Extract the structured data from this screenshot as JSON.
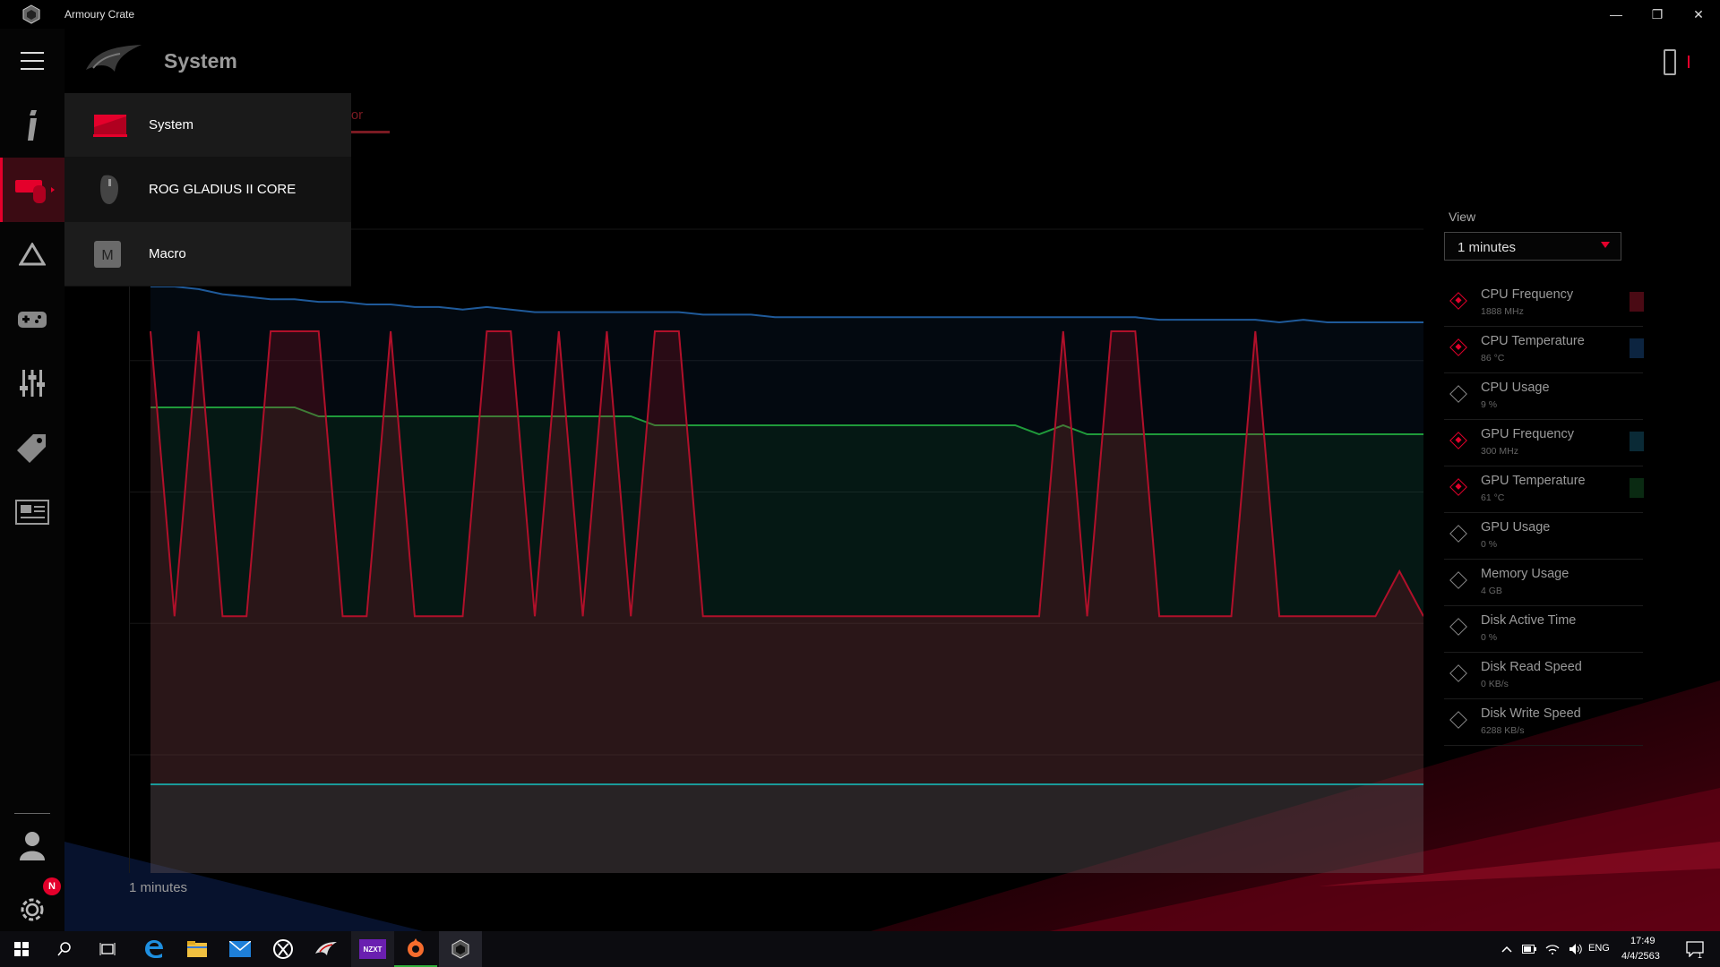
{
  "window": {
    "title": "Armoury Crate",
    "controls": [
      "—",
      "❐",
      "✕"
    ]
  },
  "header": {
    "title": "System",
    "tab_label": "nitor"
  },
  "dropdown": {
    "items": [
      {
        "label": "System",
        "icon": "laptop-icon"
      },
      {
        "label": "ROG GLADIUS II CORE",
        "icon": "mouse-icon"
      },
      {
        "label": "Macro",
        "icon": "macro-icon"
      }
    ]
  },
  "rail": {
    "items": [
      "info-icon",
      "devices-icon",
      "aura-icon",
      "gamevisual-icon",
      "settings-sliders-icon",
      "deals-icon",
      "news-icon"
    ],
    "bottom": [
      "user-icon",
      "gear-icon"
    ],
    "badge": "N"
  },
  "view": {
    "label": "View",
    "selected": "1  minutes"
  },
  "chart_footer": "1  minutes",
  "metrics": [
    {
      "name": "CPU Frequency",
      "value": "1888 MHz",
      "on": true,
      "color": "#4a0a14"
    },
    {
      "name": "CPU Temperature",
      "value": "86 °C",
      "on": true,
      "color": "#0c2440"
    },
    {
      "name": "CPU Usage",
      "value": "9 %",
      "on": false,
      "color": ""
    },
    {
      "name": "GPU Frequency",
      "value": "300 MHz",
      "on": true,
      "color": "#0a2a36"
    },
    {
      "name": "GPU Temperature",
      "value": "61 °C",
      "on": true,
      "color": "#0a2a12"
    },
    {
      "name": "GPU Usage",
      "value": "0 %",
      "on": false,
      "color": ""
    },
    {
      "name": "Memory Usage",
      "value": "4 GB",
      "on": false,
      "color": ""
    },
    {
      "name": "Disk Active Time",
      "value": "0 %",
      "on": false,
      "color": ""
    },
    {
      "name": "Disk Read Speed",
      "value": "0 KB/s",
      "on": false,
      "color": ""
    },
    {
      "name": "Disk Write Speed",
      "value": "6288 KB/s",
      "on": false,
      "color": ""
    }
  ],
  "chart_data": {
    "type": "area",
    "series": [
      {
        "color": "#1f5a9a",
        "values": [
          100,
          100,
          99,
          97,
          96,
          95,
          95,
          94,
          94,
          93,
          93,
          92,
          92,
          91,
          92,
          91,
          90,
          90,
          90,
          90,
          90,
          90,
          90,
          89,
          89,
          89,
          88,
          88,
          88,
          88,
          88,
          88,
          88,
          88,
          88,
          88,
          88,
          88,
          88,
          88,
          88,
          88,
          87,
          87,
          87,
          87,
          87,
          86,
          87,
          86,
          86,
          86,
          86,
          86
        ]
      },
      {
        "color": "#1f9a3a",
        "values": [
          65,
          65,
          65,
          65,
          65,
          65,
          65,
          64,
          64,
          64,
          64,
          64,
          64,
          64,
          64,
          64,
          64,
          64,
          64,
          64,
          64,
          63,
          63,
          63,
          63,
          63,
          63,
          63,
          63,
          63,
          63,
          63,
          63,
          63,
          63,
          63,
          63,
          62,
          63,
          62,
          62,
          62,
          62,
          62,
          62,
          62,
          62,
          62,
          62,
          62,
          62,
          62,
          62,
          62
        ]
      },
      {
        "color": "#b0102a",
        "values": [
          40,
          2,
          40,
          2,
          2,
          40,
          40,
          40,
          2,
          2,
          40,
          2,
          2,
          2,
          40,
          40,
          2,
          40,
          2,
          40,
          2,
          40,
          40,
          2,
          2,
          2,
          2,
          2,
          2,
          2,
          2,
          2,
          2,
          2,
          2,
          2,
          2,
          2,
          40,
          2,
          40,
          40,
          2,
          2,
          2,
          2,
          40,
          2,
          2,
          2,
          2,
          2,
          8,
          2
        ]
      },
      {
        "color": "#1a9a9a",
        "values": [
          10,
          10,
          10,
          10,
          10,
          10,
          10,
          10,
          10,
          10,
          10,
          10,
          10,
          10,
          10,
          10,
          10,
          10,
          10,
          10,
          10,
          10,
          10,
          10,
          10,
          10,
          10,
          10,
          10,
          10,
          10,
          10,
          10,
          10,
          10,
          10,
          10,
          10,
          10,
          10,
          10,
          10,
          10,
          10,
          10,
          10,
          10,
          10,
          10,
          10,
          10,
          10,
          10,
          10
        ]
      }
    ]
  },
  "taskbar": {
    "apps": [
      "windows-start-icon",
      "search-icon",
      "task-view-icon",
      "edge-icon",
      "file-explorer-icon",
      "mail-icon",
      "xbox-icon",
      "rog-gaming-icon",
      "nzxt-icon",
      "origin-icon",
      "armoury-crate-icon"
    ],
    "nzxt_label": "NZXT",
    "lang": "ENG",
    "time": "17:49",
    "date": "4/4/2563",
    "notif_count": "1"
  }
}
